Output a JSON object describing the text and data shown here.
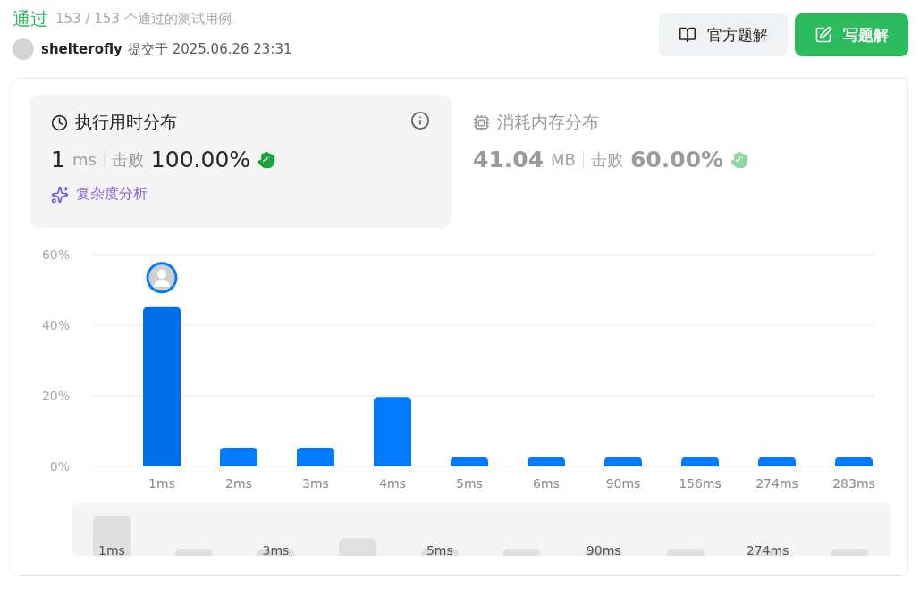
{
  "header": {
    "status": "通过",
    "cases": "153 / 153 个通过的测试用例",
    "user": "shelterofly",
    "submitted": "提交于 2025.06.26 23:31"
  },
  "buttons": [
    {
      "label": "官方题解",
      "kind": "secondary"
    },
    {
      "label": "写题解",
      "kind": "primary"
    }
  ],
  "stats": [
    {
      "title": "执行用时分布",
      "selected": true,
      "value": "1",
      "unit": "ms",
      "beat_label": "击败",
      "beat": "100.00%",
      "kind": "time",
      "link": "复杂度分析"
    },
    {
      "title": "消耗内存分布",
      "selected": false,
      "value": "41.04",
      "unit": "MB",
      "beat_label": "击败",
      "beat": "60.00%",
      "kind": "memory"
    }
  ],
  "chart_data": {
    "type": "bar",
    "categories": [
      "1ms",
      "2ms",
      "3ms",
      "4ms",
      "5ms",
      "6ms",
      "90ms",
      "156ms",
      "274ms",
      "283ms"
    ],
    "stacked": true,
    "series": [
      {
        "color": "#006ee6",
        "values": [
          45.1,
          null,
          null,
          null,
          null,
          null,
          null,
          null,
          null,
          null
        ]
      },
      {
        "color": "#007aff",
        "values": [
          null,
          5.3,
          5.3,
          19.7,
          2.6,
          2.6,
          2.6,
          2.6,
          2.6,
          2.6
        ]
      }
    ],
    "ylim": [
      0,
      60
    ],
    "yticks": [
      {
        "value": 0,
        "label": "0%"
      },
      {
        "value": 20,
        "label": "20%"
      },
      {
        "value": 40,
        "label": "40%"
      },
      {
        "value": 60,
        "label": "60%"
      }
    ]
  },
  "overview_labels": [
    "1ms",
    "3ms",
    "5ms",
    "90ms",
    "274ms"
  ]
}
